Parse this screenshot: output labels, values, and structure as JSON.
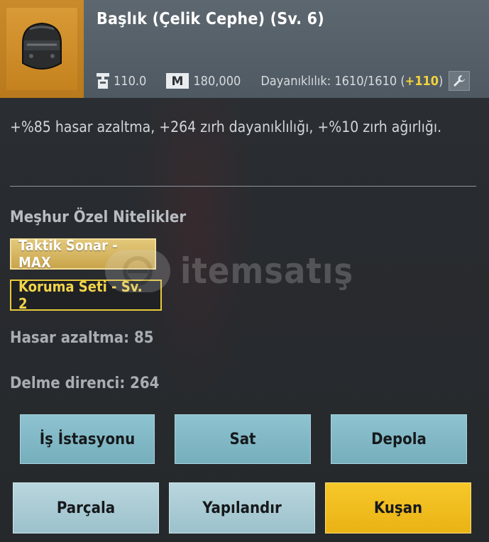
{
  "item": {
    "title": "Başlık (Çelik Cephe) (Sv. 6)",
    "weight": "110.0",
    "price": "180,000",
    "durability_label": "Dayanıklılık: 1610/1610 (",
    "durability_bonus": "+110",
    "durability_close": ")"
  },
  "description": "+%85 hasar azaltma, +264 zırh dayanıklılığı, +%10 zırh ağırlığı.",
  "traits": {
    "section_title": "Meşhur Özel Nitelikler",
    "items": [
      "Taktik Sonar - MAX",
      "Koruma Seti - Sv. 2"
    ]
  },
  "stats": {
    "damage_reduction": "Hasar azaltma: 85",
    "penetration_resist": "Delme direnci: 264"
  },
  "watermark": {
    "text": "itemsatış"
  },
  "buttons": {
    "workstation": "İş İstasyonu",
    "sell": "Sat",
    "store": "Depola",
    "dismantle": "Parçala",
    "configure": "Yapılandır",
    "equip": "Kuşan"
  },
  "colors": {
    "accent_gold": "#f1d44a",
    "button_blue": "#82b8c6",
    "button_yellow": "#f3c020",
    "thumb_orange": "#c88a2a"
  },
  "icons": {
    "weight": "weight-icon",
    "currency": "m-coin-icon",
    "repair": "wrench-icon",
    "item": "helmet-icon"
  }
}
